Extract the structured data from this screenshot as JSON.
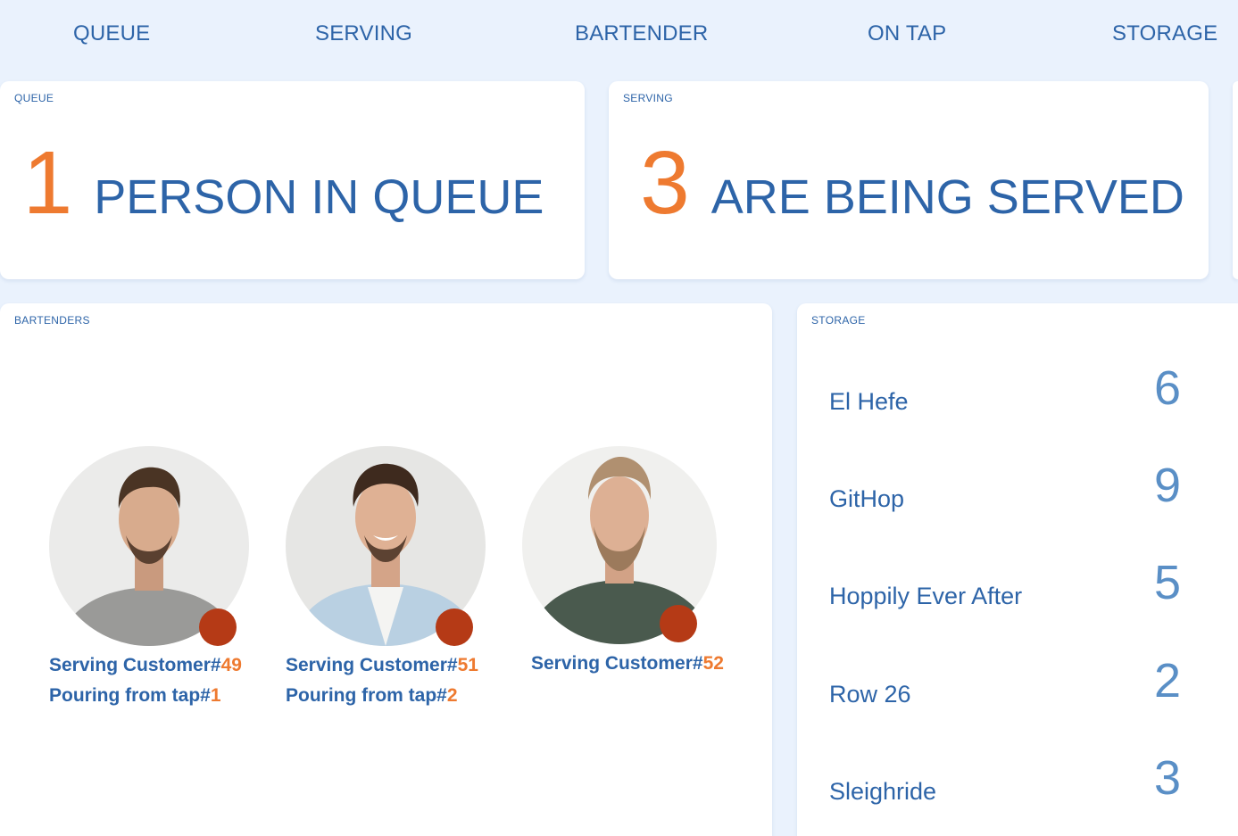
{
  "nav": {
    "items": [
      {
        "label": "QUEUE"
      },
      {
        "label": "SERVING"
      },
      {
        "label": "BARTENDER"
      },
      {
        "label": "ON TAP"
      },
      {
        "label": "STORAGE"
      }
    ]
  },
  "queue": {
    "label": "QUEUE",
    "count": "1",
    "text": "PERSON IN QUEUE"
  },
  "serving": {
    "label": "SERVING",
    "count": "3",
    "text": "ARE BEING SERVED"
  },
  "bartenders": {
    "label": "BARTENDERS",
    "items": [
      {
        "serving_prefix": "Serving Customer#",
        "customer": "49",
        "pouring_prefix": "Pouring from tap#",
        "tap": "1"
      },
      {
        "serving_prefix": "Serving Customer#",
        "customer": "51",
        "pouring_prefix": "Pouring from tap#",
        "tap": "2"
      },
      {
        "serving_prefix": "Serving Customer#",
        "customer": "52"
      }
    ]
  },
  "storage": {
    "label": "STORAGE",
    "items": [
      {
        "name": "El Hefe",
        "count": "6"
      },
      {
        "name": "GitHop",
        "count": "9"
      },
      {
        "name": "Hoppily Ever After",
        "count": "5"
      },
      {
        "name": "Row 26",
        "count": "2"
      },
      {
        "name": "Sleighride",
        "count": "3"
      }
    ]
  },
  "colors": {
    "background": "#eaf2fd",
    "primary_text": "#2d64a8",
    "accent": "#ee7a30",
    "status_dot": "#b53a16",
    "storage_count": "#5a8fc6"
  }
}
